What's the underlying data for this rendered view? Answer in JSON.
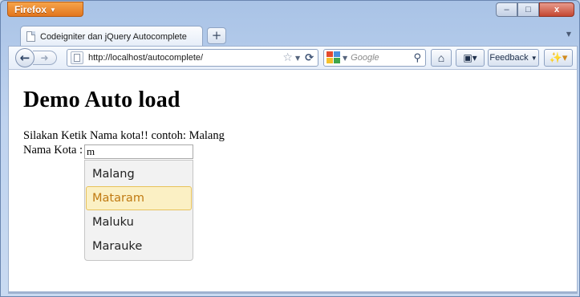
{
  "browser": {
    "menu_button": "Firefox",
    "tab_title": "Codeigniter dan jQuery Autocomplete",
    "new_tab": "+",
    "url": "http://localhost/autocomplete/",
    "search_placeholder": "Google",
    "feedback_label": "Feedback",
    "window_controls": {
      "minimize": "–",
      "maximize": "□",
      "close": "x"
    }
  },
  "page": {
    "heading": "Demo Auto load",
    "instruction": "Silakan Ketik Nama kota!! contoh: Malang",
    "field_label": "Nama Kota :",
    "input_value": "m",
    "suggestions": [
      "Malang",
      "Mataram",
      "Maluku",
      "Marauke"
    ],
    "highlighted_index": 1
  },
  "colors": {
    "firefox_orange": "#e2761e",
    "highlight_bg": "#fbf0c4",
    "highlight_border": "#e8c25a",
    "highlight_text": "#c07a12"
  }
}
